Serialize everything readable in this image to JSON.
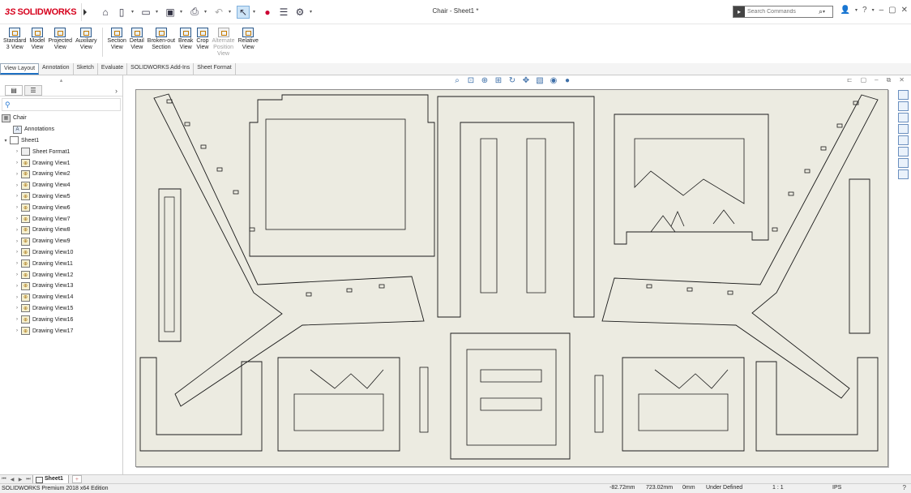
{
  "app": {
    "logo_ds": "3S",
    "logo_name": "SOLIDWORKS",
    "window_title": "Chair - Sheet1 *",
    "search_placeholder": "Search Commands"
  },
  "command_manager": {
    "buttons": [
      {
        "label": "Standard\n3 View",
        "enabled": true
      },
      {
        "label": "Model\nView",
        "enabled": true
      },
      {
        "label": "Projected\nView",
        "enabled": true
      },
      {
        "label": "Auxiliary\nView",
        "enabled": true
      },
      {
        "label": "Section\nView",
        "enabled": true
      },
      {
        "label": "Detail\nView",
        "enabled": true
      },
      {
        "label": "Broken-out\nSection",
        "enabled": true
      },
      {
        "label": "Break\nView",
        "enabled": true
      },
      {
        "label": "Crop\nView",
        "enabled": true
      },
      {
        "label": "Alternate\nPosition\nView",
        "enabled": false
      },
      {
        "label": "Relative\nView",
        "enabled": true
      }
    ]
  },
  "tabs": [
    "View Layout",
    "Annotation",
    "Sketch",
    "Evaluate",
    "SOLIDWORKS Add-Ins",
    "Sheet Format"
  ],
  "active_tab": "View Layout",
  "feature_tree": {
    "root": "Chair",
    "annotations": "Annotations",
    "sheet": "Sheet1",
    "sheet_format": "Sheet Format1",
    "views": [
      "Drawing View1",
      "Drawing View2",
      "Drawing View4",
      "Drawing View5",
      "Drawing View6",
      "Drawing View7",
      "Drawing View8",
      "Drawing View9",
      "Drawing View10",
      "Drawing View11",
      "Drawing View12",
      "Drawing View13",
      "Drawing View14",
      "Drawing View15",
      "Drawing View16",
      "Drawing View17"
    ]
  },
  "sheet_tab": "Sheet1",
  "status": {
    "product": "SOLIDWORKS Premium 2018 x64 Edition",
    "x": "-82.72mm",
    "y": "723.02mm",
    "z": "0mm",
    "state": "Under Defined",
    "scale": "1 : 1",
    "units": "IPS"
  },
  "icons": {
    "home": "home-icon",
    "new": "new-document-icon",
    "open": "open-folder-icon",
    "save": "save-icon",
    "print": "print-icon",
    "undo": "undo-icon",
    "select": "select-pointer-icon",
    "rebuild": "rebuild-traffic-light-icon",
    "file_props": "file-properties-icon",
    "options": "gear-icon",
    "user": "user-icon",
    "help": "help-icon"
  }
}
